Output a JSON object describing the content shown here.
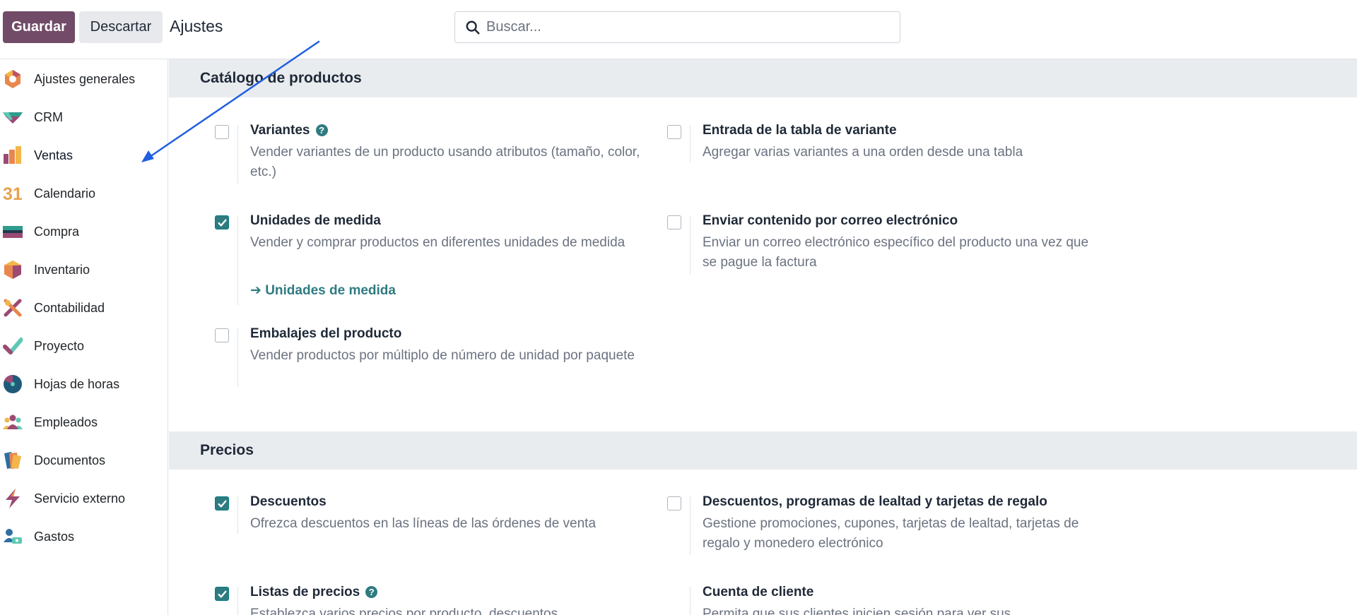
{
  "controls": {
    "save_label": "Guardar",
    "discard_label": "Descartar",
    "title": "Ajustes",
    "search_placeholder": "Buscar..."
  },
  "sidebar": {
    "items": [
      {
        "label": "Ajustes generales",
        "icon": "ajustes-generales-icon"
      },
      {
        "label": "CRM",
        "icon": "crm-icon"
      },
      {
        "label": "Ventas",
        "icon": "ventas-icon"
      },
      {
        "label": "Calendario",
        "icon": "calendario-icon"
      },
      {
        "label": "Compra",
        "icon": "compra-icon"
      },
      {
        "label": "Inventario",
        "icon": "inventario-icon"
      },
      {
        "label": "Contabilidad",
        "icon": "contabilidad-icon"
      },
      {
        "label": "Proyecto",
        "icon": "proyecto-icon"
      },
      {
        "label": "Hojas de horas",
        "icon": "hojas-de-horas-icon"
      },
      {
        "label": "Empleados",
        "icon": "empleados-icon"
      },
      {
        "label": "Documentos",
        "icon": "documentos-icon"
      },
      {
        "label": "Servicio externo",
        "icon": "servicio-externo-icon"
      },
      {
        "label": "Gastos",
        "icon": "gastos-icon"
      }
    ],
    "calendar_icon_text": "31"
  },
  "catalog": {
    "title": "Catálogo de productos",
    "variantes": {
      "title": "Variantes",
      "desc": "Vender variantes de un producto usando atributos (tamaño, color, etc.)",
      "checked": false
    },
    "tabla_variante": {
      "title": "Entrada de la tabla de variante",
      "desc": "Agregar varias variantes a una orden desde una tabla",
      "checked": false
    },
    "unidades": {
      "title": "Unidades de medida",
      "desc": "Vender y comprar productos en diferentes unidades de medida",
      "link": "Unidades de medida",
      "checked": true
    },
    "correo": {
      "title": "Enviar contenido por correo electrónico",
      "desc": "Enviar un correo electrónico específico del producto una vez que se pague la factura",
      "checked": false
    },
    "embalajes": {
      "title": "Embalajes del producto",
      "desc": "Vender productos por múltiplo de número de unidad por paquete",
      "checked": false
    }
  },
  "precios": {
    "title": "Precios",
    "descuentos": {
      "title": "Descuentos",
      "desc": "Ofrezca descuentos en las líneas de las órdenes de venta",
      "checked": true
    },
    "lealtad": {
      "title": "Descuentos, programas de lealtad y tarjetas de regalo",
      "desc": "Gestione promociones, cupones, tarjetas de lealtad, tarjetas de regalo y monedero electrónico",
      "checked": false
    },
    "listas": {
      "title": "Listas de precios",
      "desc": "Establezca varios precios por producto, descuentos",
      "checked": true
    },
    "cuenta": {
      "title": "Cuenta de cliente",
      "desc": "Permita que sus clientes inicien sesión para ver sus"
    }
  },
  "colors": {
    "brand": "#714b67",
    "accent": "#2f7b80",
    "annotation_arrow": "#1f5fe0"
  }
}
